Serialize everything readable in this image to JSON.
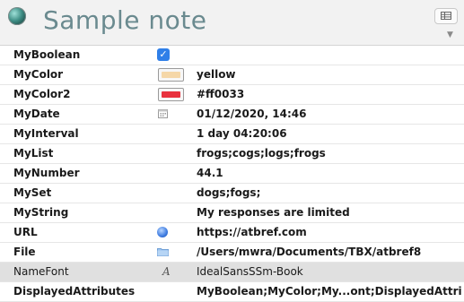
{
  "header": {
    "title": "Sample note",
    "view_icon": "table-view-icon",
    "dropdown_glyph": "▼"
  },
  "rows": [
    {
      "name": "MyBoolean",
      "icon": "checkbox-checked",
      "value": ""
    },
    {
      "name": "MyColor",
      "icon": "color-swatch",
      "swatch": "#f5d7a8",
      "value": "yellow"
    },
    {
      "name": "MyColor2",
      "icon": "color-swatch",
      "swatch": "#e8323e",
      "value": "#ff0033"
    },
    {
      "name": "MyDate",
      "icon": "calendar-icon",
      "value": "01/12/2020, 14:46"
    },
    {
      "name": "MyInterval",
      "icon": "",
      "value": "1 day 04:20:06"
    },
    {
      "name": "MyList",
      "icon": "",
      "value": "frogs;cogs;logs;frogs"
    },
    {
      "name": "MyNumber",
      "icon": "",
      "value": "44.1"
    },
    {
      "name": "MySet",
      "icon": "",
      "value": "dogs;fogs;"
    },
    {
      "name": "MyString",
      "icon": "",
      "value": "My responses are limited"
    },
    {
      "name": "URL",
      "icon": "globe-icon",
      "value": "https://atbref.com"
    },
    {
      "name": "File",
      "icon": "folder-icon",
      "value": "/Users/mwra/Documents/TBX/atbref8"
    },
    {
      "name": "NameFont",
      "icon": "font-icon",
      "icon_text": "A",
      "value": "IdealSansSSm-Book"
    },
    {
      "name": "DisplayedAttributes",
      "icon": "",
      "value": "MyBoolean;MyColor;My...ont;DisplayedAttributes"
    }
  ],
  "checkmark": "✓",
  "colors": {
    "title": "#6a8a8f",
    "header_bg": "#f2f2f2",
    "selected_row": "#e0e0e0",
    "checkbox": "#2f7fe8"
  }
}
